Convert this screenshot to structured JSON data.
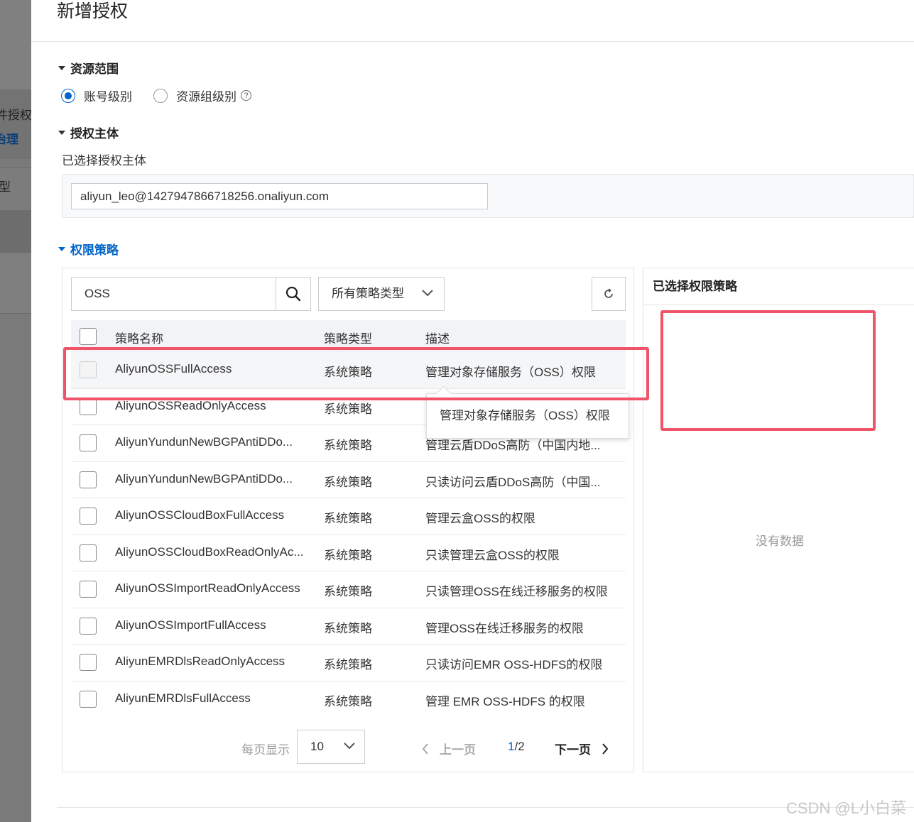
{
  "background_page": {
    "fragment_1": "件授权",
    "fragment_2": "治理",
    "fragment_3": "型"
  },
  "drawer": {
    "title": "新增授权"
  },
  "resource_scope": {
    "heading": "资源范围",
    "options": [
      {
        "label": "账号级别",
        "checked": true
      },
      {
        "label": "资源组级别",
        "checked": false
      }
    ]
  },
  "principal": {
    "heading": "授权主体",
    "selected_label": "已选择授权主体",
    "value": "aliyun_leo@1427947866718256.onaliyun.com"
  },
  "policies": {
    "heading": "权限策略",
    "search_value": "OSS",
    "type_filter": "所有策略类型",
    "columns": [
      "策略名称",
      "策略类型",
      "描述"
    ],
    "rows": [
      {
        "name": "AliyunOSSFullAccess",
        "type": "系统策略",
        "desc": "管理对象存储服务（OSS）权限"
      },
      {
        "name": "AliyunOSSReadOnlyAccess",
        "type": "系统策略",
        "desc": ""
      },
      {
        "name": "AliyunYundunNewBGPAntiDDo...",
        "type": "系统策略",
        "desc": "管理云盾DDoS高防（中国内地..."
      },
      {
        "name": "AliyunYundunNewBGPAntiDDo...",
        "type": "系统策略",
        "desc": "只读访问云盾DDoS高防（中国..."
      },
      {
        "name": "AliyunOSSCloudBoxFullAccess",
        "type": "系统策略",
        "desc": "管理云盒OSS的权限"
      },
      {
        "name": "AliyunOSSCloudBoxReadOnlyAc...",
        "type": "系统策略",
        "desc": "只读管理云盒OSS的权限"
      },
      {
        "name": "AliyunOSSImportReadOnlyAccess",
        "type": "系统策略",
        "desc": "只读管理OSS在线迁移服务的权限"
      },
      {
        "name": "AliyunOSSImportFullAccess",
        "type": "系统策略",
        "desc": "管理OSS在线迁移服务的权限"
      },
      {
        "name": "AliyunEMRDlsReadOnlyAccess",
        "type": "系统策略",
        "desc": "只读访问EMR OSS-HDFS的权限"
      },
      {
        "name": "AliyunEMRDlsFullAccess",
        "type": "系统策略",
        "desc": "管理 EMR OSS-HDFS 的权限"
      }
    ],
    "tooltip": "管理对象存储服务（OSS）权限",
    "pagination": {
      "per_page_label": "每页显示",
      "per_page_value": "10",
      "prev_label": "上一页",
      "current_page": "1",
      "page_total": "/2",
      "next_label": "下一页"
    }
  },
  "selected_panel": {
    "heading": "已选择权限策略",
    "empty_text": "没有数据"
  },
  "watermark": "CSDN @L小白菜"
}
